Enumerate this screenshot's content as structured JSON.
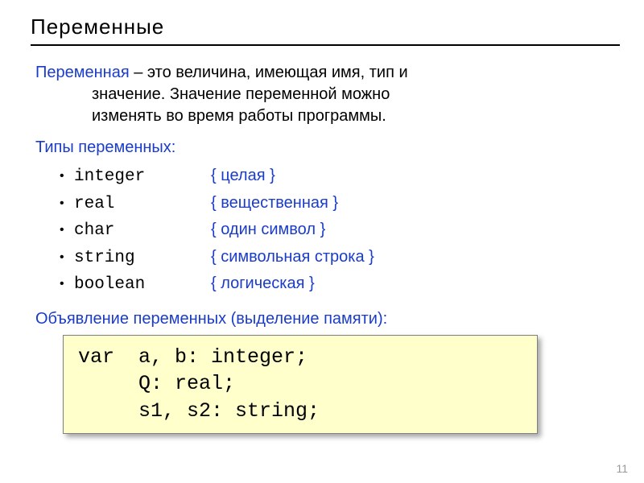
{
  "title": "Переменные",
  "definition": {
    "term": "Переменная",
    "line1": " – это величина, имеющая имя, тип и",
    "line2": "значение. Значение переменной можно",
    "line3": "изменять во время работы программы."
  },
  "types_heading": "Типы переменных:",
  "types": [
    {
      "name": "integer",
      "desc": "{ целая }"
    },
    {
      "name": "real",
      "desc": "{ вещественная }"
    },
    {
      "name": "char",
      "desc": "{ один символ }"
    },
    {
      "name": "string",
      "desc": "{ символьная строка }"
    },
    {
      "name": "boolean",
      "desc": "{ логическая }"
    }
  ],
  "decl_heading": "Объявление переменных (выделение памяти):",
  "code": {
    "l1": "var  a, b: integer;",
    "l2": "     Q: real;",
    "l3": "     s1, s2: string;"
  },
  "page_number": "11"
}
